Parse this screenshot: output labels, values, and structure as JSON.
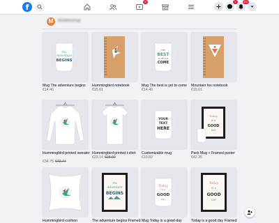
{
  "topbar": {
    "logo_letter": "f",
    "nav": [
      {
        "name": "home"
      },
      {
        "name": "friends"
      },
      {
        "name": "watch",
        "badge": "9"
      },
      {
        "name": "marketplace"
      },
      {
        "name": "menu"
      }
    ],
    "notifications_badge": "20+",
    "messenger_badge": "1"
  },
  "page": {
    "avatar_letter": "M",
    "name": "Modeloshop"
  },
  "products": [
    {
      "name": "Mug The adventure begins",
      "price": "€14.40",
      "old_price": "",
      "art": "mug-adventure"
    },
    {
      "name": "Hummingbird notebook",
      "price": "€15.61",
      "old_price": "",
      "art": "notebook-bird"
    },
    {
      "name": "Mug The best is yet to come",
      "price": "€14.40",
      "old_price": "",
      "art": "mug-best"
    },
    {
      "name": "Mountain fox notebook",
      "price": "€15.61",
      "old_price": "",
      "art": "notebook-fox"
    },
    {
      "name": "Hummingbird printed sweater",
      "price": "€34.75",
      "old_price": "€43.44",
      "art": "sweater"
    },
    {
      "name": "Hummingbird printed t-shirt",
      "price": "€23.14",
      "old_price": "€28.92",
      "art": "tshirt"
    },
    {
      "name": "Customizable mug",
      "price": "€10.82",
      "old_price": "",
      "art": "mug-custom"
    },
    {
      "name": "Pack Mug + Framed poster",
      "price": "€42.35",
      "old_price": "",
      "art": "pack"
    },
    {
      "name": "Hummingbird cushion",
      "price": "",
      "old_price": "",
      "art": "cushion"
    },
    {
      "name": "The adventure begins Framed",
      "price": "",
      "old_price": "",
      "art": "poster-adventure"
    },
    {
      "name": "Mug Today is a good day",
      "price": "",
      "old_price": "",
      "art": "mug-today"
    },
    {
      "name": "Today is a good day Framed",
      "price": "",
      "old_price": "",
      "art": "poster-today"
    }
  ]
}
